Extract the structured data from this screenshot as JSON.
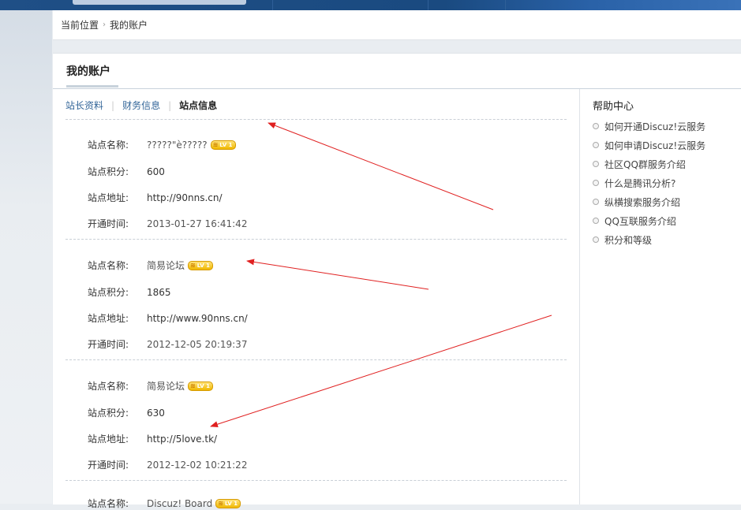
{
  "breadcrumb": {
    "location_label": "当前位置",
    "sep": "›",
    "current": "我的账户"
  },
  "panel": {
    "title": "我的账户"
  },
  "tabs": [
    {
      "label": "站长资料",
      "active": false
    },
    {
      "label": "财务信息",
      "active": false
    },
    {
      "label": "站点信息",
      "active": true
    }
  ],
  "field_labels": {
    "name": "站点名称:",
    "points": "站点积分:",
    "url": "站点地址:",
    "opened": "开通时间:"
  },
  "badge": {
    "text": "LV 1",
    "icon": "wifi-wave-icon"
  },
  "sites": [
    {
      "name": "?????\"è?????",
      "points": "600",
      "url": "http://90nns.cn/",
      "opened": "2013-01-27 16:41:42"
    },
    {
      "name": "简易论坛",
      "points": "1865",
      "url": "http://www.90nns.cn/",
      "opened": "2012-12-05 20:19:37"
    },
    {
      "name": "简易论坛",
      "points": "630",
      "url": "http://5love.tk/",
      "opened": "2012-12-02 10:21:22"
    },
    {
      "name": "Discuz! Board",
      "points": "",
      "url": "",
      "opened": ""
    }
  ],
  "help": {
    "title": "帮助中心",
    "items": [
      "如何开通Discuz!云服务",
      "如何申请Discuz!云服务",
      "社区QQ群服务介绍",
      "什么是腾讯分析?",
      "纵横搜索服务介绍",
      "QQ互联服务介绍",
      "积分和等级"
    ]
  },
  "colors": {
    "link": "#336699",
    "arrow": "#e02020",
    "accent_bar": "#1f4f86"
  }
}
